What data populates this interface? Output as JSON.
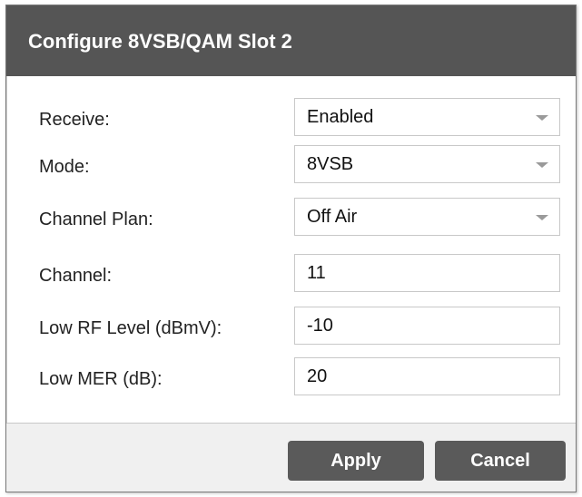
{
  "dialog": {
    "title": "Configure 8VSB/QAM Slot 2"
  },
  "form": {
    "receive": {
      "label": "Receive:",
      "value": "Enabled",
      "icon": "chevron-down-icon"
    },
    "mode": {
      "label": "Mode:",
      "value": "8VSB",
      "icon": "chevron-down-icon"
    },
    "channel_plan": {
      "label": "Channel Plan:",
      "value": "Off Air",
      "icon": "chevron-down-icon"
    },
    "channel": {
      "label": "Channel:",
      "value": "11"
    },
    "low_rf_level": {
      "label": "Low RF Level (dBmV):",
      "value": "-10"
    },
    "low_mer": {
      "label": "Low MER (dB):",
      "value": "20"
    }
  },
  "footer": {
    "apply_label": "Apply",
    "cancel_label": "Cancel"
  },
  "colors": {
    "title_bar": "#555555",
    "button": "#5a5a5a",
    "footer_bg": "#f0f0f0"
  }
}
